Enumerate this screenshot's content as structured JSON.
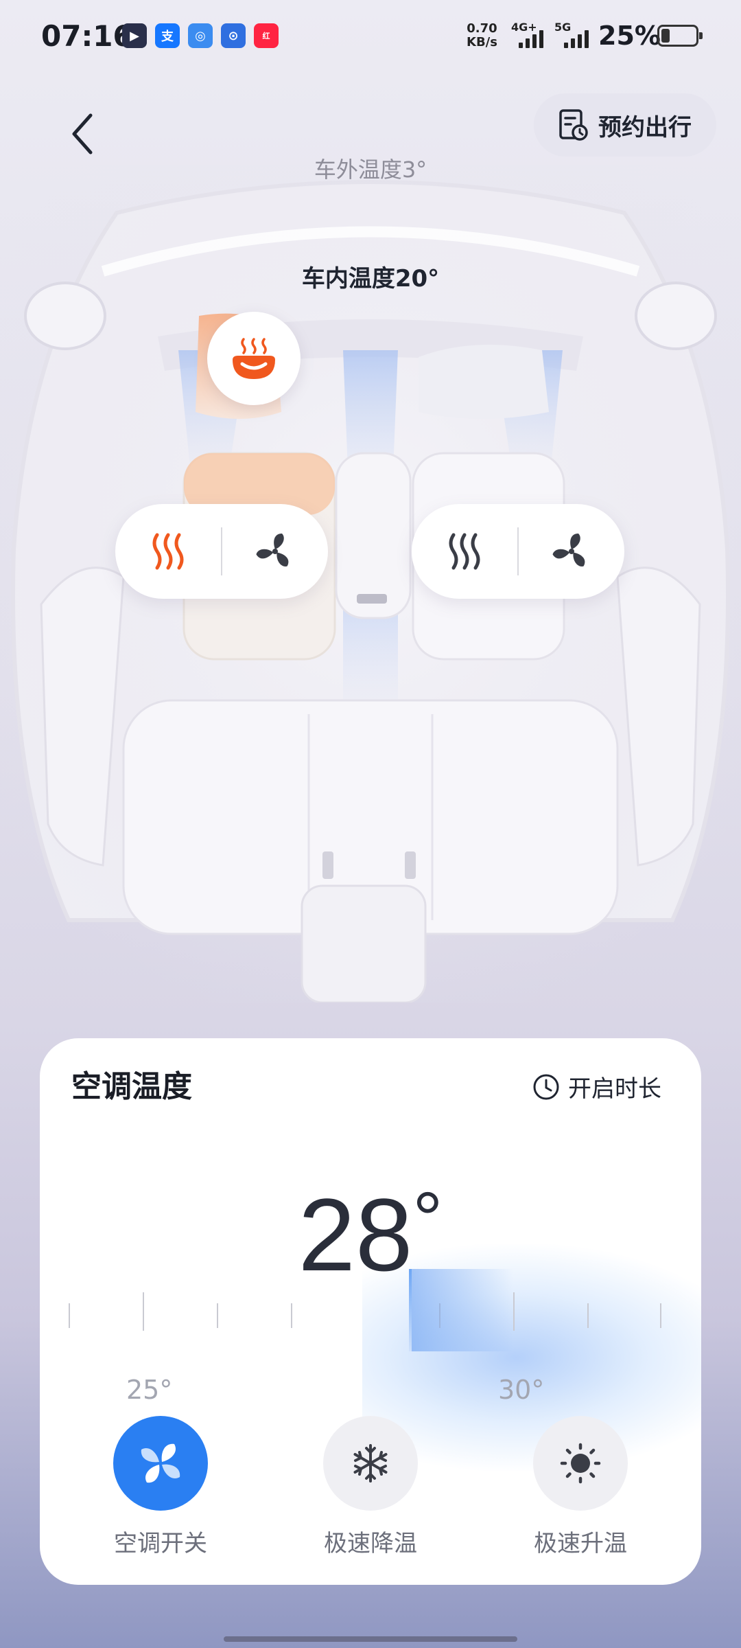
{
  "status_bar": {
    "time": "07:16",
    "app_icons": [
      "play-app-icon",
      "alipay-icon",
      "browser-icon",
      "nfc-app-icon",
      "xiaohongshu-icon"
    ],
    "net_speed_value": "0.70",
    "net_speed_unit": "KB/s",
    "sim1_label": "4G+",
    "sim2_label": "5G",
    "battery_percent": "25%",
    "battery_level": 0.25
  },
  "header": {
    "reserve_label": "预约出行",
    "outside_temp": "车外温度3°",
    "inside_temp": "车内温度20°"
  },
  "seats": {
    "steering_heat": {
      "icon": "steering-wheel-heat-icon",
      "active": true
    },
    "driver": {
      "heat_active": true,
      "ventilation_active": false
    },
    "passenger": {
      "heat_active": false,
      "ventilation_active": false
    }
  },
  "ac_card": {
    "title": "空调温度",
    "timer_label": "开启时长",
    "temperature_value": "28",
    "temperature_unit": "°",
    "scale_min_label": "25°",
    "scale_max_label": "30°",
    "buttons": [
      {
        "label": "空调开关",
        "icon": "fan-icon",
        "active": true
      },
      {
        "label": "极速降温",
        "icon": "snowflake-icon",
        "active": false
      },
      {
        "label": "极速升温",
        "icon": "sun-icon",
        "active": false
      }
    ]
  },
  "colors": {
    "accent_blue": "#2a7ff2",
    "heat_orange": "#f0581e",
    "icon_dark": "#3a3d46"
  }
}
